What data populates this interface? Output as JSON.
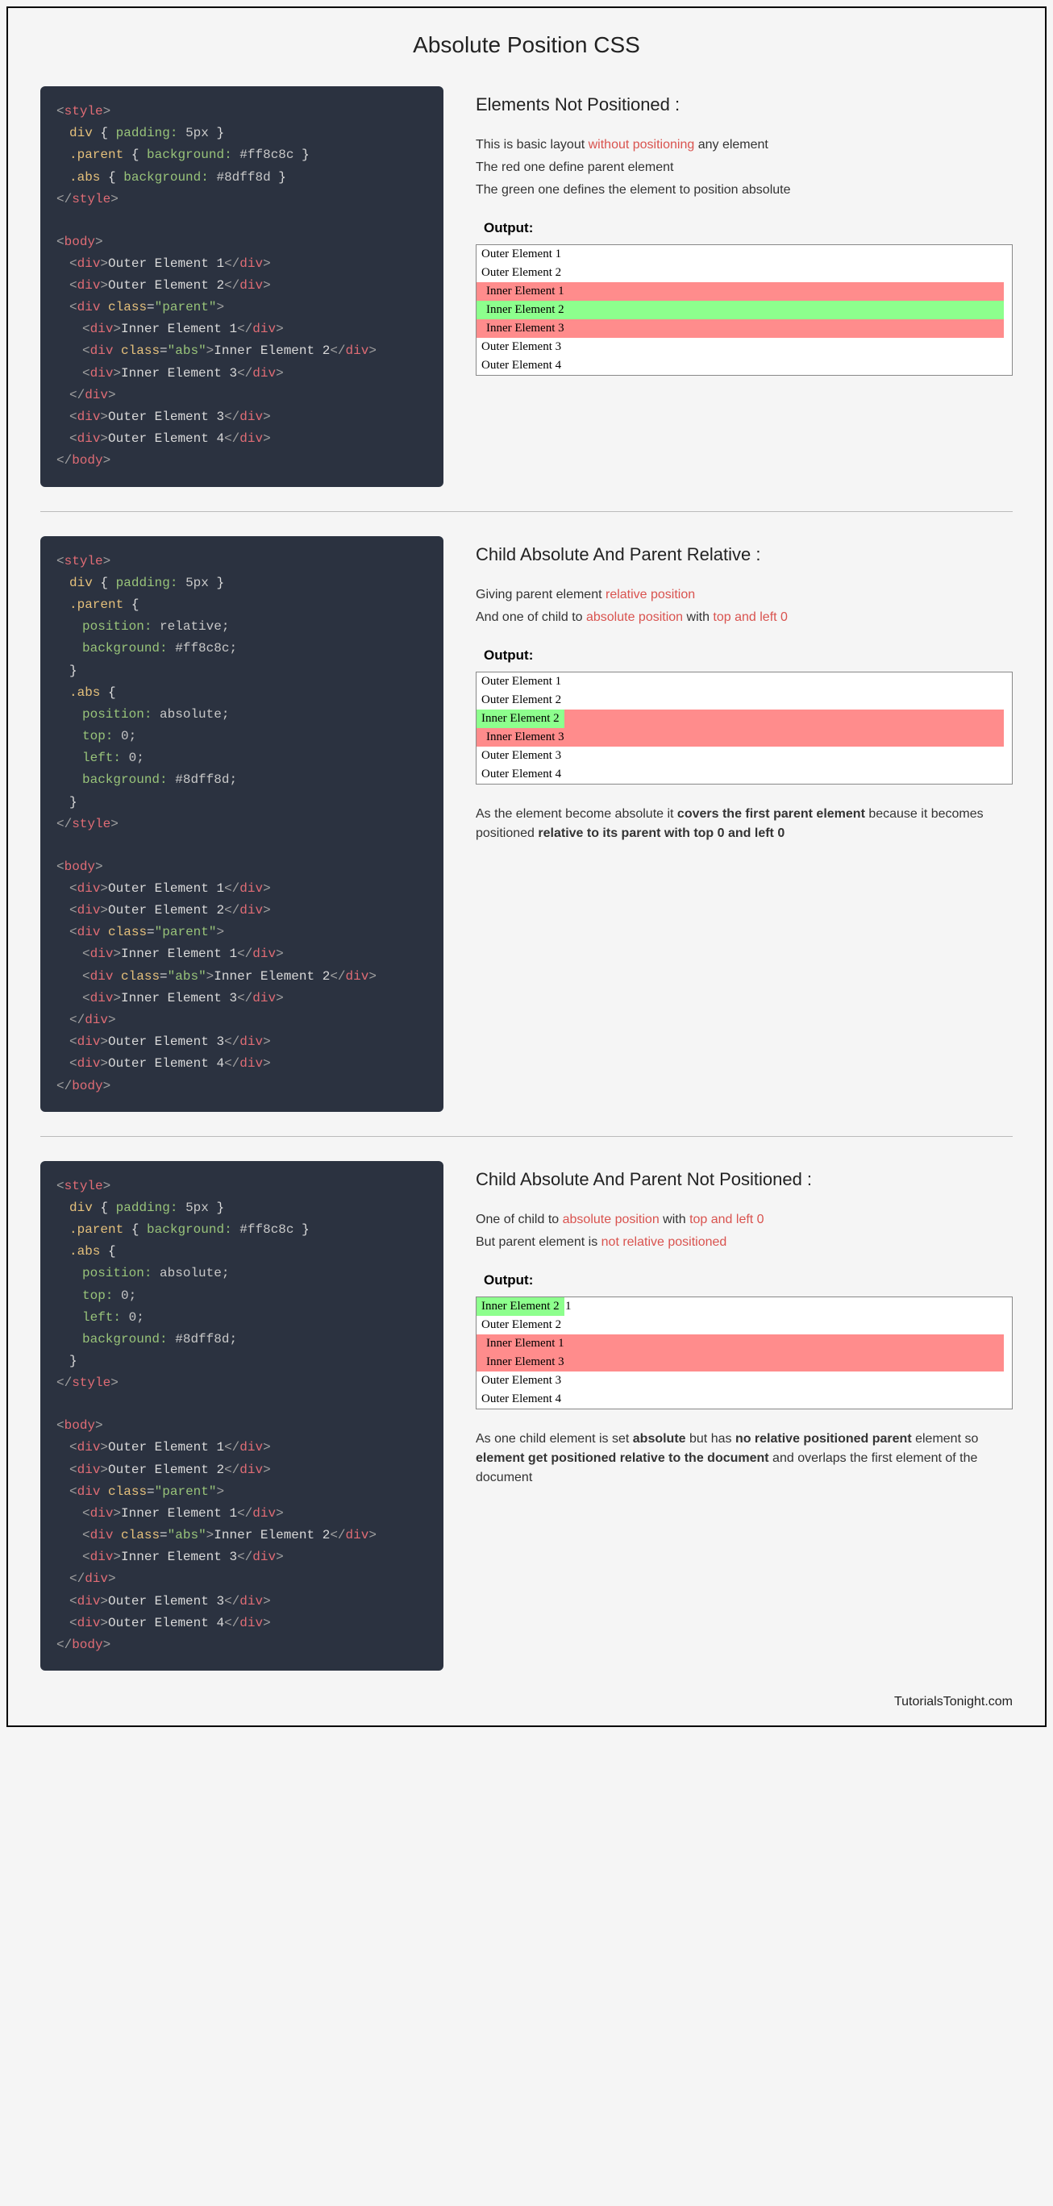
{
  "title": "Absolute Position CSS",
  "footer": "TutorialsTonight.com",
  "sections": [
    {
      "heading": "Elements Not Positioned :",
      "desc": [
        {
          "pre": "This is basic layout ",
          "hl": "without positioning",
          "post": " any element"
        },
        {
          "pre": "The red one define parent element",
          "hl": "",
          "post": ""
        },
        {
          "pre": "The green one defines the element to position absolute",
          "hl": "",
          "post": ""
        }
      ],
      "output_label": "Output:",
      "output_rows": {
        "o1": "Outer Element 1",
        "o2": "Outer Element 2",
        "i1": "Inner Element 1",
        "i2": "Inner Element 2",
        "i3": "Inner Element 3",
        "o3": "Outer Element 3",
        "o4": "Outer Element 4"
      },
      "code": {
        "style_open": "style",
        "rule1_sel": "div",
        "rule1_prop": "padding:",
        "rule1_val": "5px",
        "rule2_sel": ".parent",
        "rule2_prop": "background:",
        "rule2_val": "#ff8c8c",
        "rule3_sel": ".abs",
        "rule3_prop": "background:",
        "rule3_val": "#8dff8d",
        "body": "body",
        "div": "div",
        "oe1": "Outer Element 1",
        "oe2": "Outer Element 2",
        "class": "class",
        "parent": "\"parent\"",
        "abs": "\"abs\"",
        "ie1": "Inner Element 1",
        "ie2": "Inner Element 2",
        "ie3": "Inner Element 3",
        "oe3": "Outer Element 3",
        "oe4": "Outer Element 4"
      }
    },
    {
      "heading": "Child Absolute And Parent Relative :",
      "desc": [
        {
          "pre": "Giving parent element ",
          "hl": "relative position",
          "post": ""
        },
        {
          "pre": "And one of child to ",
          "hl": "absolute position",
          "post": " with ",
          "hl2": "top and left 0"
        }
      ],
      "output_label": "Output:",
      "output_rows": {
        "o1": "Outer Element 1",
        "o2": "Outer Element 2",
        "i2": "Inner Element 2",
        "i3": "Inner Element 3",
        "o3": "Outer Element 3",
        "o4": "Outer Element 4"
      },
      "after": {
        "t1": "As the element become absolute it ",
        "b1": "covers the first parent element",
        "t2": " because it becomes positioned ",
        "b2": "relative to its parent with top 0 and left 0"
      },
      "code": {
        "rule1_sel": "div",
        "rule1_prop": "padding:",
        "rule1_val": "5px",
        "parent_sel": ".parent",
        "p_prop1": "position:",
        "p_val1": "relative;",
        "p_prop2": "background:",
        "p_val2": "#ff8c8c;",
        "abs_sel": ".abs",
        "a_prop1": "position:",
        "a_val1": "absolute;",
        "a_prop2": "top:",
        "a_val2": "0;",
        "a_prop3": "left:",
        "a_val3": "0;",
        "a_prop4": "background:",
        "a_val4": "#8dff8d;"
      }
    },
    {
      "heading": "Child Absolute And Parent Not Positioned :",
      "desc": [
        {
          "pre": "One of child to ",
          "hl": "absolute position",
          "post": " with ",
          "hl2": "top and left 0"
        },
        {
          "pre": "But parent element is ",
          "hl": "not relative positioned",
          "post": ""
        }
      ],
      "output_label": "Output:",
      "output_rows": {
        "i2": "Inner Element 2",
        "o1_tail": "1",
        "o2": "Outer Element 2",
        "i1": "Inner Element 1",
        "i3": "Inner Element 3",
        "o3": "Outer Element 3",
        "o4": "Outer Element 4"
      },
      "after": {
        "t1": "As one child element is set ",
        "b1": "absolute",
        "t2": " but has ",
        "b2": "no relative positioned parent",
        "t3": " element so ",
        "b3": "element get positioned relative to the document",
        "t4": " and overlaps the first element of the document"
      },
      "code": {
        "rule1_sel": "div",
        "rule1_prop": "padding:",
        "rule1_val": "5px",
        "rule2_sel": ".parent",
        "rule2_prop": "background:",
        "rule2_val": "#ff8c8c",
        "abs_sel": ".abs",
        "a_prop1": "position:",
        "a_val1": "absolute;",
        "a_prop2": "top:",
        "a_val2": "0;",
        "a_prop3": "left:",
        "a_val3": "0;",
        "a_prop4": "background:",
        "a_val4": "#8dff8d;"
      }
    }
  ]
}
